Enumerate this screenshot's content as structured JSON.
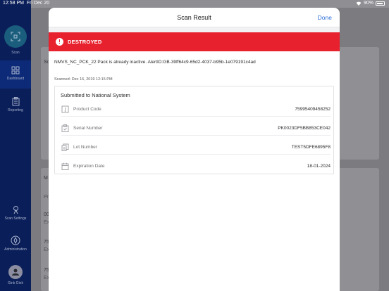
{
  "status_bar": {
    "time": "12:58 PM",
    "date": "Fri Dec 20",
    "battery": "90%"
  },
  "sidebar": {
    "items": [
      {
        "label": "Scan",
        "icon": "scan-icon"
      },
      {
        "label": "Dashboard",
        "icon": "dashboard-icon"
      },
      {
        "label": "Reporting",
        "icon": "reporting-icon"
      },
      {
        "label": "Scan Settings",
        "icon": "scan-settings-icon"
      },
      {
        "label": "Administration",
        "icon": "administration-icon"
      },
      {
        "label": "Gink Gink",
        "icon": "user-avatar-icon"
      }
    ]
  },
  "background": {
    "section_s": "Sc",
    "section_m": "M",
    "col_p": "Pr",
    "rows": [
      {
        "a": "00",
        "b": "Ex"
      },
      {
        "a": "75",
        "b": "Ex"
      },
      {
        "a": "75",
        "b": "Ex"
      }
    ]
  },
  "modal": {
    "title": "Scan Result",
    "done_label": "Done",
    "alert_label": "DESTROYED",
    "message": "NMVS_NC_PCK_22 Pack is already inactive. AlertID:GB-39ff64c9-65d2-4037-b95b-1e079191c4ad",
    "scanned": "Scanned: Dec 16, 2019 12:15 PM",
    "card_title": "Submitted to National System",
    "fields": [
      {
        "label": "Product Code",
        "value": "75995409458252",
        "icon": "product-code-icon"
      },
      {
        "label": "Serial Number",
        "value": "PK0023DF5BB853CE042",
        "icon": "serial-number-icon"
      },
      {
        "label": "Lot Number",
        "value": "TEST5DFE6895F8",
        "icon": "lot-number-icon"
      },
      {
        "label": "Expiration Date",
        "value": "18-01-2024",
        "icon": "calendar-icon"
      }
    ]
  },
  "colors": {
    "alert": "#e8212e",
    "accent": "#2f6fd6",
    "sidebar": "#0a1e59"
  }
}
